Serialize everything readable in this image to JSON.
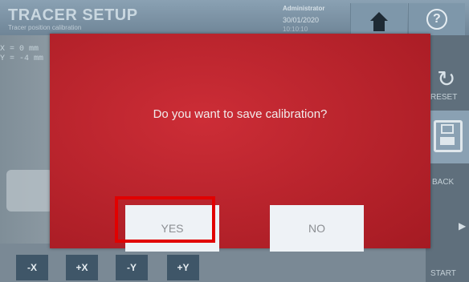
{
  "header": {
    "title": "TRACER SETUP",
    "subtitle": "Tracer position calibration",
    "user": "Administrator",
    "date": "30/01/2020",
    "time": "10:10:10",
    "home_icon": "home-icon",
    "help_label": "?"
  },
  "coords": {
    "x": "X = 0 mm",
    "y": "Y = -4 mm"
  },
  "side_buttons": {
    "reset_label": "RESET",
    "back_label": "BACK",
    "start_label": "START",
    "reset_icon": "reset-icon",
    "save_icon": "save-icon"
  },
  "jog_buttons": [
    "-X",
    "+X",
    "-Y",
    "+Y"
  ],
  "dialog": {
    "message": "Do you want to save calibration?",
    "yes_label": "YES",
    "no_label": "NO",
    "color": "#c9202a"
  }
}
